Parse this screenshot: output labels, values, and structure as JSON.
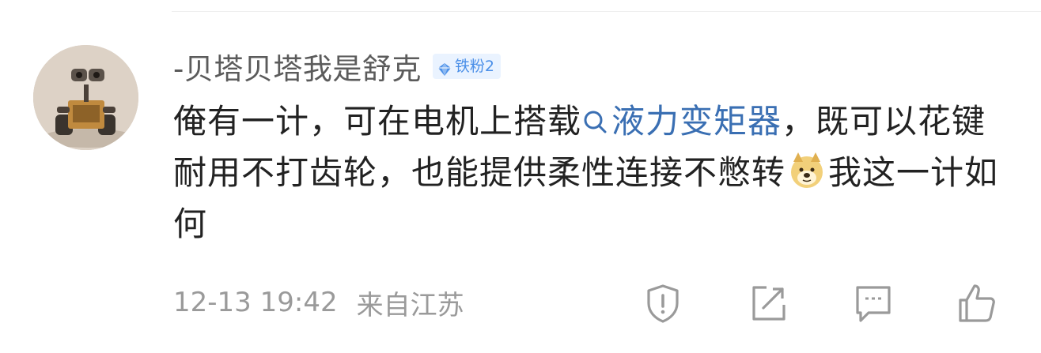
{
  "comment": {
    "username": "-贝塔贝塔我是舒克",
    "fan_badge": {
      "icon": "diamond-icon",
      "label": "铁粉2",
      "color": "#4a8fe8",
      "background": "#eaf3ff"
    },
    "text_part1": "俺有一计，可在电机上搭载",
    "topic": {
      "icon": "search-icon",
      "label": "液力变矩器",
      "color": "#3a6fb3"
    },
    "text_part2": "，既可以花键耐用不打齿轮，也能提供柔性连接不憋转",
    "emoji": "doge-emoji",
    "text_part3": "我这一计如何",
    "timestamp": "12-13 19:42",
    "source": "来自江苏"
  },
  "actions": [
    {
      "icon": "report-icon"
    },
    {
      "icon": "share-icon"
    },
    {
      "icon": "comment-icon"
    },
    {
      "icon": "like-icon"
    }
  ],
  "colors": {
    "text": "#222222",
    "meta": "#9a9a9a",
    "username": "#5b5b5b"
  }
}
